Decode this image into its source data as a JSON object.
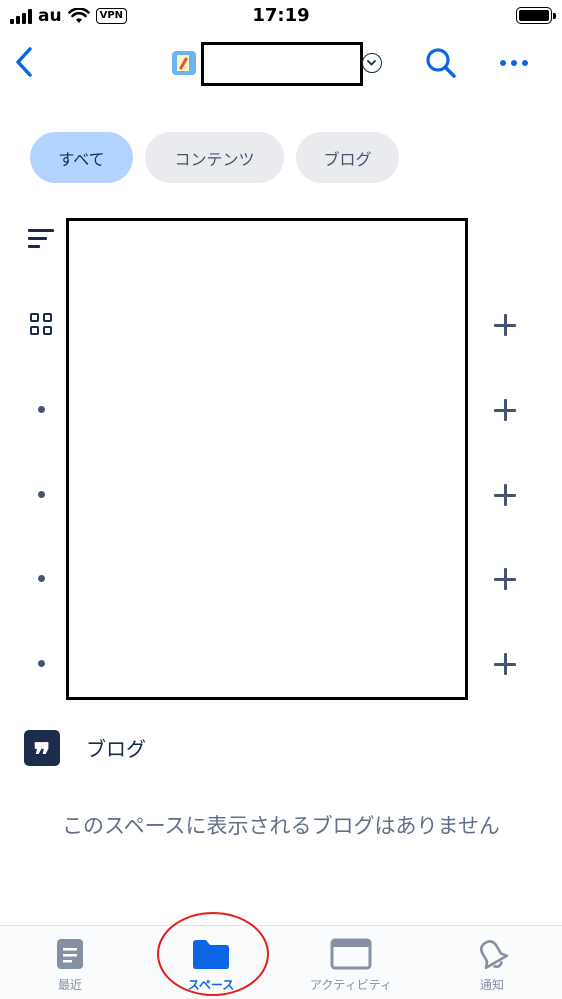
{
  "status_bar": {
    "carrier": "au",
    "vpn_label": "VPN",
    "time": "17:19"
  },
  "header": {
    "back_icon": "chevron-left-icon",
    "space_icon": "notebook-icon",
    "title": "",
    "chevron_icon": "chevron-down-circle-icon",
    "search_icon": "search-icon",
    "more_icon": "more-horizontal-icon"
  },
  "filters": {
    "all": "すべて",
    "content": "コンテンツ",
    "blog": "ブログ"
  },
  "tree": {
    "sort_icon": "sort-icon",
    "grid_icon": "grid-icon"
  },
  "blog_section": {
    "icon": "quote-icon",
    "icon_glyph": "❞",
    "title": "ブログ",
    "empty_message": "このスペースに表示されるブログはありません"
  },
  "tabbar": {
    "recent": "最近",
    "spaces": "スペース",
    "activity": "アクティビティ",
    "notifications": "通知"
  },
  "colors": {
    "accent": "#0c66e4",
    "chip_active": "#b3d4ff",
    "chip_inactive": "#e9ebee",
    "text_primary": "#172b4d",
    "text_subtle": "#626f86",
    "annotation_red": "#e2211c"
  }
}
